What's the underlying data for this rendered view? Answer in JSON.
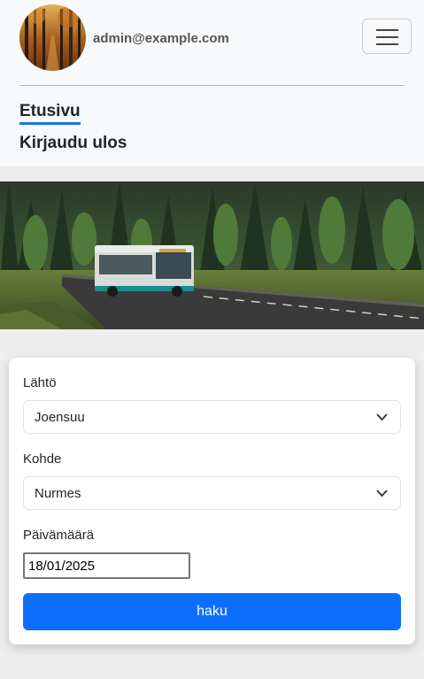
{
  "header": {
    "user_email": "admin@example.com",
    "avatar_name": "avatar-image",
    "menu_icon": "hamburger-menu-icon"
  },
  "nav": {
    "items": [
      {
        "label": "Etusivu",
        "active": true
      },
      {
        "label": "Kirjaudu ulos",
        "active": false
      }
    ]
  },
  "hero": {
    "description_icon": "bus-forest-photo"
  },
  "search_form": {
    "departure_label": "Lähtö",
    "departure_value": "Joensuu",
    "destination_label": "Kohde",
    "destination_value": "Nurmes",
    "date_label": "Päivämäärä",
    "date_value": "18/01/2025",
    "submit_label": "haku"
  },
  "colors": {
    "accent": "#0d6efd",
    "active_underline": "#1a73e8",
    "navbar_bg": "#f8f9fa",
    "page_bg": "#eeeeee"
  }
}
